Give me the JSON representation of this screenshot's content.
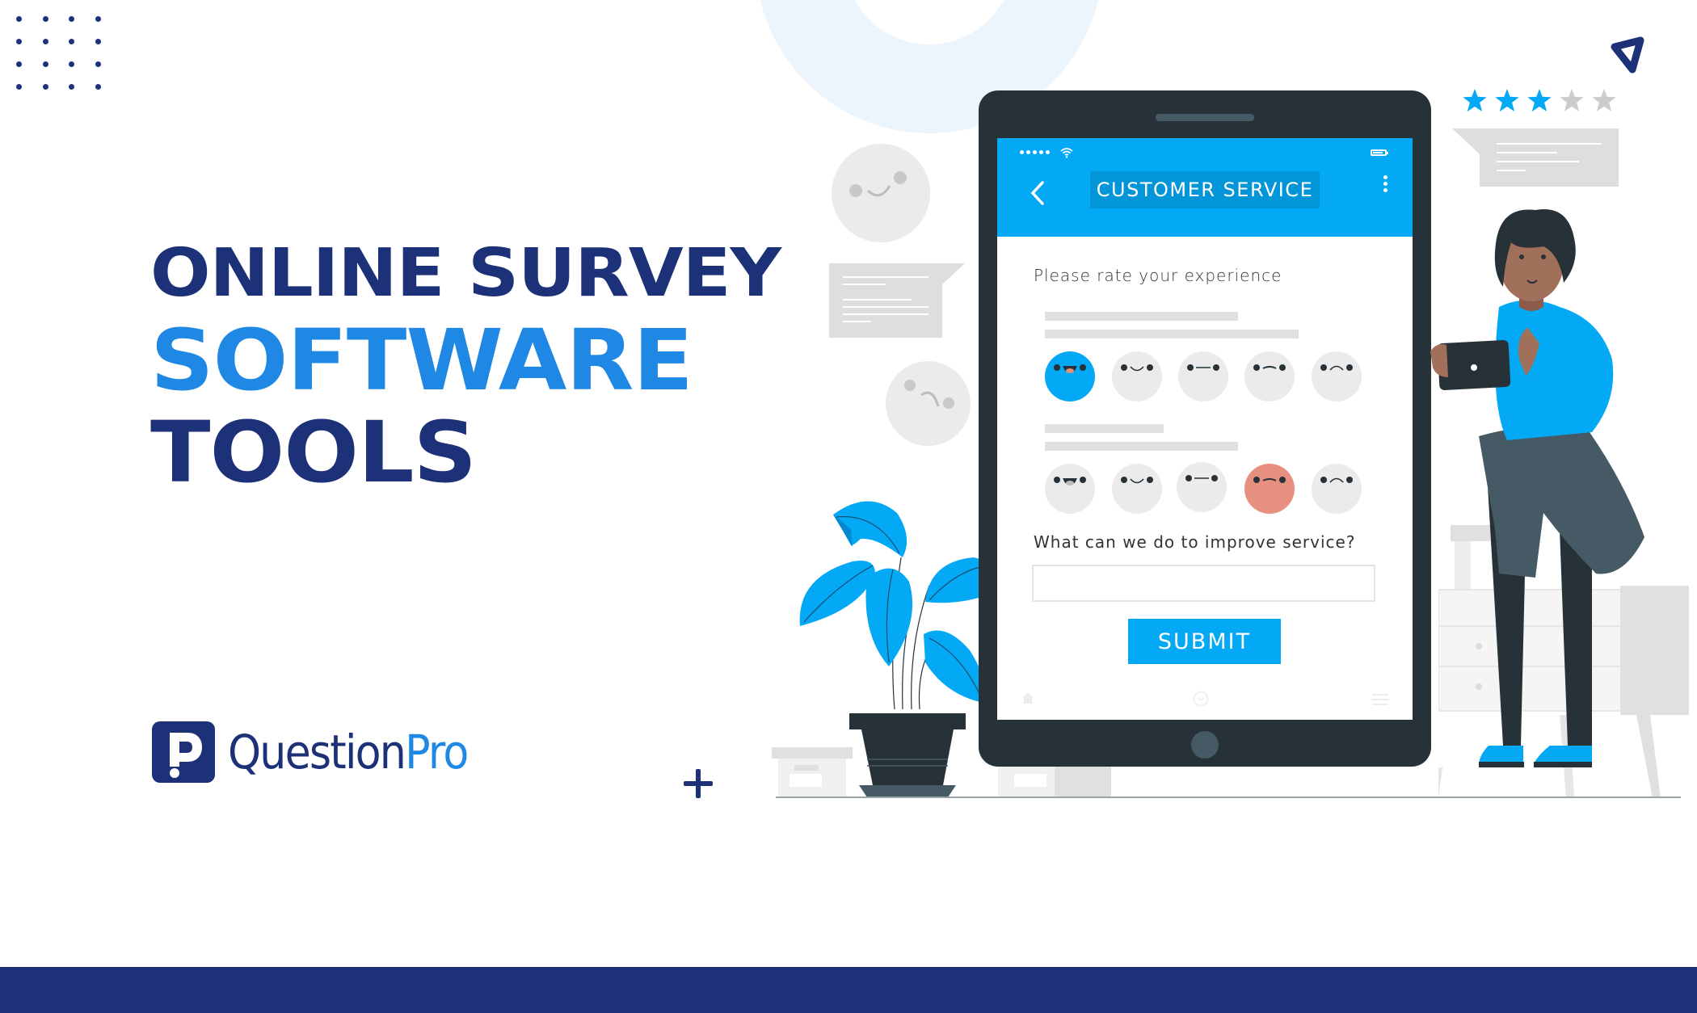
{
  "headline": {
    "line1": "ONLINE SURVEY",
    "line2": "SOFTWARE",
    "line3": "TOOLS"
  },
  "brand": {
    "name_part1": "Question",
    "name_part2": "Pro",
    "primary_color": "#1d3178",
    "accent_color": "#1f88e5"
  },
  "tablet_app": {
    "header_title": "CUSTOMER SERVICE",
    "header_color": "#03a9f4",
    "back_icon": "chevron-left-icon",
    "menu_icon": "kebab-menu-icon",
    "status_bar": {
      "signal_dots": 5,
      "wifi_icon": "wifi-icon",
      "battery_icon": "battery-icon"
    },
    "question1": "Please rate your experience",
    "rating_row1": {
      "options": [
        "very-happy",
        "happy",
        "neutral",
        "unhappy",
        "sad"
      ],
      "selected_index": 0,
      "selected_color": "#03a9f4"
    },
    "rating_row2": {
      "options": [
        "very-happy",
        "happy",
        "neutral",
        "unhappy",
        "sad"
      ],
      "selected_index": 3,
      "selected_color": "#e8907f"
    },
    "question2": "What can we do to improve service?",
    "answer_value": "",
    "submit_label": "SUBMIT",
    "bottom_nav": [
      "home-icon",
      "check-circle-icon",
      "menu-icon"
    ]
  },
  "star_rating": {
    "value": 3,
    "max": 5,
    "filled_color": "#03a9f4",
    "empty_color": "#cccccc"
  },
  "footer_band_color": "#1d3178"
}
